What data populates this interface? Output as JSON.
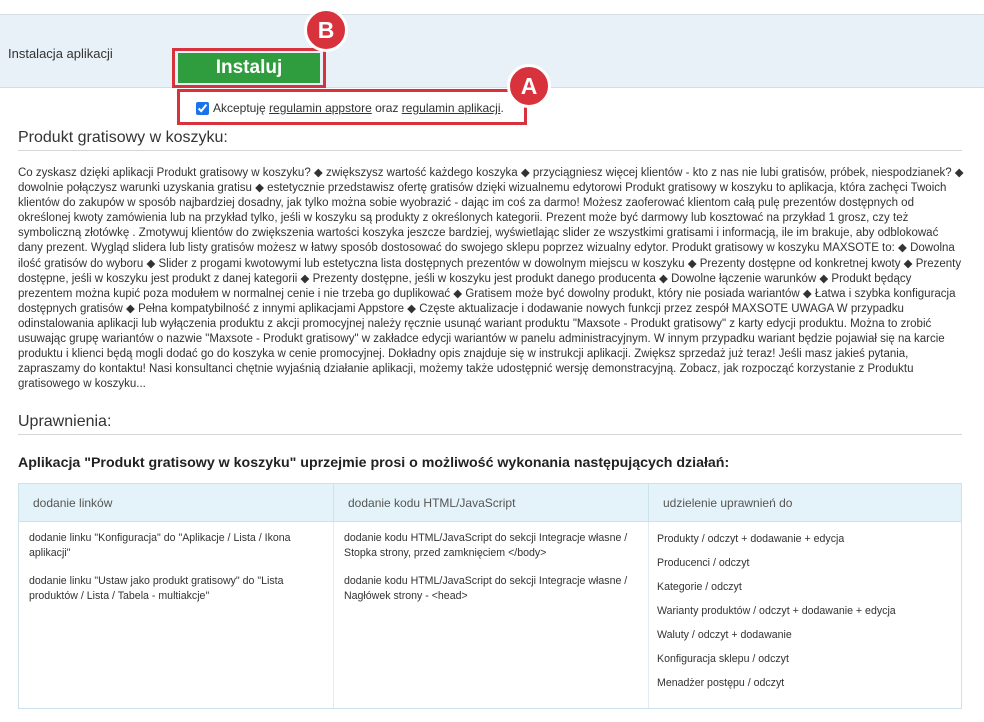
{
  "install": {
    "label": "Instalacja aplikacji",
    "button_label": "Instaluj",
    "badge_b": "B",
    "badge_a": "A",
    "accent_color": "#d8323c",
    "button_color": "#2f9d3e"
  },
  "accept": {
    "checked": true,
    "text_before": "Akceptuję ",
    "link1": "regulamin appstore",
    "text_mid": " oraz ",
    "link2": "regulamin aplikacji",
    "text_after": "."
  },
  "product": {
    "title": "Produkt gratisowy w koszyku:",
    "description": "Co zyskasz dzięki aplikacji Produkt gratisowy w koszyku? ◆ zwiększysz wartość każdego koszyka ◆ przyciągniesz więcej klientów - kto z nas nie lubi gratisów, próbek, niespodzianek? ◆ dowolnie połączysz warunki uzyskania gratisu ◆ estetycznie przedstawisz ofertę gratisów dzięki wizualnemu edytorowi Produkt gratisowy w koszyku to aplikacja, która zachęci Twoich klientów do zakupów w sposób najbardziej dosadny, jak tylko można sobie wyobrazić - dając im coś za darmo! Możesz zaoferować klientom całą pulę prezentów dostępnych od określonej kwoty zamówienia lub na przykład tylko, jeśli w koszyku są produkty z określonych kategorii. Prezent może być darmowy lub kosztować na przykład 1 grosz, czy też symboliczną złotówkę . Zmotywuj klientów do zwiększenia wartości koszyka jeszcze bardziej, wyświetlając slider ze wszystkimi gratisami i informacją, ile im brakuje, aby odblokować dany prezent. Wygląd slidera lub listy gratisów możesz w łatwy sposób dostosować do swojego sklepu poprzez wizualny edytor. Produkt gratisowy w koszyku MAXSOTE to: ◆ Dowolna ilość gratisów do wyboru ◆ Slider z progami kwotowymi lub estetyczna lista dostępnych prezentów w dowolnym miejscu w koszyku ◆ Prezenty dostępne od konkretnej kwoty ◆ Prezenty dostępne, jeśli w koszyku jest produkt z danej kategorii ◆ Prezenty dostępne, jeśli w koszyku jest produkt danego producenta ◆ Dowolne łączenie warunków ◆ Produkt będący prezentem można kupić poza modułem w normalnej cenie i nie trzeba go duplikować ◆ Gratisem może być dowolny produkt, który nie posiada wariantów ◆ Łatwa i szybka konfiguracja dostępnych gratisów ◆ Pełna kompatybilność z innymi aplikacjami Appstore ◆ Częste aktualizacje i dodawanie nowych funkcji przez zespół MAXSOTE UWAGA W przypadku odinstalowania aplikacji lub wyłączenia produktu z akcji promocyjnej należy ręcznie usunąć wariant produktu \"Maxsote - Produkt gratisowy\" z karty edycji produktu. Można to zrobić usuwając grupę wariantów o nazwie \"Maxsote - Produkt gratisowy\" w zakładce edycji wariantów w panelu administracyjnym. W innym przypadku wariant będzie pojawiał się na karcie produktu i klienci będą mogli dodać go do koszyka w cenie promocyjnej. Dokładny opis znajduje się w instrukcji aplikacji. Zwiększ sprzedaż już teraz! Jeśli masz jakieś pytania, zapraszamy do kontaktu! Nasi konsultanci chętnie wyjaśnią działanie aplikacji, możemy także udostępnić wersję demonstracyjną. Zobacz, jak rozpocząć korzystanie z Produktu gratisowego w koszyku..."
  },
  "permissions": {
    "title": "Uprawnienia:",
    "heading": "Aplikacja \"Produkt gratisowy w koszyku\" uprzejmie prosi o możliwość wykonania następujących działań:",
    "columns": [
      {
        "header": "dodanie linków",
        "items": [
          "dodanie linku \"Konfiguracja\" do \"Aplikacje / Lista / Ikona aplikacji\"",
          "dodanie linku \"Ustaw jako produkt gratisowy\" do \"Lista produktów / Lista / Tabela - multiakcje\""
        ]
      },
      {
        "header": "dodanie kodu HTML/JavaScript",
        "items": [
          "dodanie kodu HTML/JavaScript do sekcji Integracje własne / Stopka strony, przed zamknięciem </body>",
          "dodanie kodu HTML/JavaScript do sekcji Integracje własne / Nagłówek strony - <head>"
        ]
      },
      {
        "header": "udzielenie uprawnień do",
        "items": [
          "Produkty / odczyt + dodawanie + edycja",
          "Producenci / odczyt",
          "Kategorie / odczyt",
          "Warianty produktów / odczyt + dodawanie + edycja",
          "Waluty / odczyt + dodawanie",
          "Konfiguracja sklepu / odczyt",
          "Menadżer postępu / odczyt"
        ]
      }
    ]
  }
}
